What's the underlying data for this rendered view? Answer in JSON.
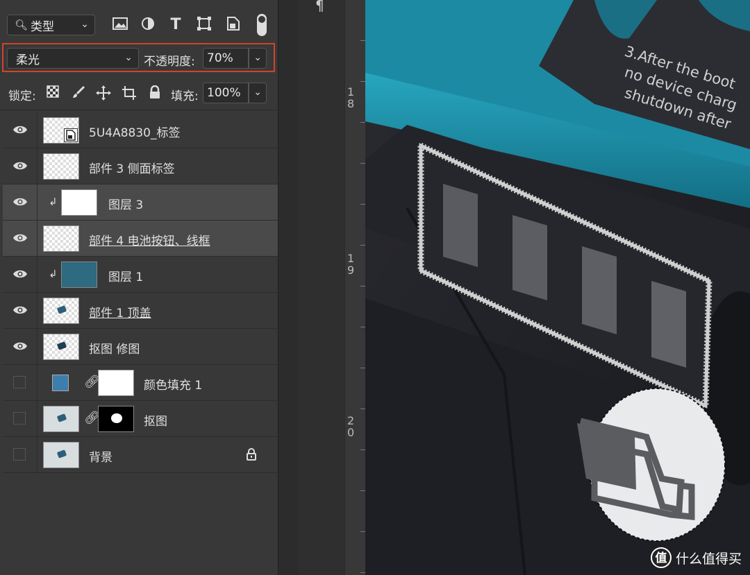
{
  "toolbar": {
    "filter_kind_label": "类型",
    "icons": [
      "image-filter-icon",
      "adjustment-filter-icon",
      "type-filter-icon",
      "shape-filter-icon",
      "smart-object-filter-icon",
      "filter-toggle-icon"
    ]
  },
  "blend": {
    "mode": "柔光",
    "opacity_label": "不透明度:",
    "opacity_value": "70%"
  },
  "lock_row": {
    "lock_label": "锁定:",
    "fill_label": "填充:",
    "fill_value": "100%",
    "icons": [
      "lock-transparent-icon",
      "lock-pixels-icon",
      "lock-position-icon",
      "lock-artboard-icon",
      "lock-all-icon"
    ]
  },
  "layers": [
    {
      "name": "5U4A8830_标签",
      "visible": true,
      "selected": false
    },
    {
      "name": "部件 3 侧面标签",
      "visible": true,
      "selected": false
    },
    {
      "name": "图层 3",
      "visible": true,
      "selected": true,
      "clipped": true
    },
    {
      "name": "部件 4 电池按钮、线框",
      "visible": true,
      "selected": true,
      "underline": true
    },
    {
      "name": "图层 1",
      "visible": true,
      "selected": false,
      "clipped": true
    },
    {
      "name": "部件 1 顶盖",
      "visible": true,
      "selected": false,
      "underline": true
    },
    {
      "name": "抠图 修图",
      "visible": true,
      "selected": false
    },
    {
      "name": "颜色填充 1",
      "visible": false,
      "selected": false
    },
    {
      "name": "抠图",
      "visible": false,
      "selected": false
    },
    {
      "name": "背景",
      "visible": false,
      "selected": false,
      "locked": true
    }
  ],
  "ruler": {
    "marks": [
      "18",
      "19",
      "20"
    ]
  },
  "canvas": {
    "label_text": [
      "3.After the boot",
      "no device charg",
      "shutdown after"
    ]
  },
  "watermark": {
    "logo": "值",
    "text": "什么值得买"
  },
  "colors": {
    "highlight_border": "#d2432b",
    "fill_swatch": "#3d7eae",
    "teal_layer": "#2e6a80"
  }
}
